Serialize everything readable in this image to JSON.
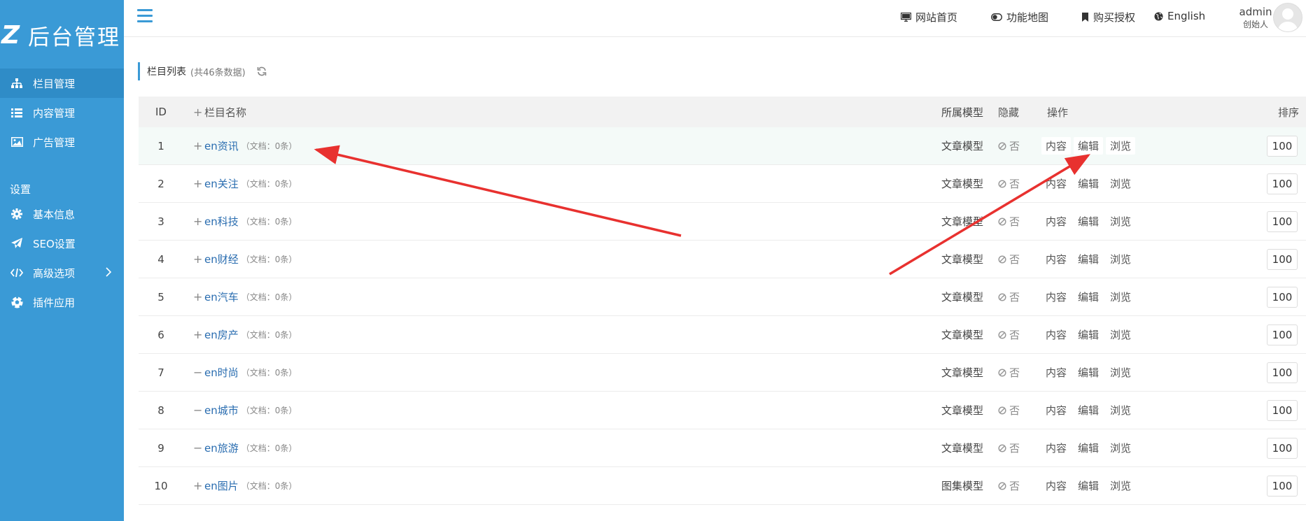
{
  "sidebar": {
    "logo_mark": "Z",
    "logo_text": "后台管理",
    "menu": [
      {
        "label": "栏目管理",
        "icon": "sitemap-icon",
        "active": true
      },
      {
        "label": "内容管理",
        "icon": "list-icon"
      },
      {
        "label": "广告管理",
        "icon": "image-icon"
      }
    ],
    "settings_label": "设置",
    "settings_menu": [
      {
        "label": "基本信息",
        "icon": "gear-icon"
      },
      {
        "label": "SEO设置",
        "icon": "paper-plane-icon"
      },
      {
        "label": "高级选项",
        "icon": "code-icon"
      },
      {
        "label": "插件应用",
        "icon": "soccer-ball-icon"
      }
    ]
  },
  "header": {
    "links": [
      {
        "label": "网站首页",
        "icon": "monitor-icon"
      },
      {
        "label": "功能地图",
        "icon": "toggle-icon"
      },
      {
        "label": "购买授权",
        "icon": "bookmark-icon"
      },
      {
        "label": "English",
        "icon": "globe-icon"
      }
    ],
    "user": {
      "name": "admin",
      "role": "创始人"
    }
  },
  "page": {
    "title": "栏目列表",
    "count_text": "(共46条数据)"
  },
  "table": {
    "columns": {
      "id": "ID",
      "name": "栏目名称",
      "model": "所属模型",
      "hidden": "隐藏",
      "ops": "操作",
      "sort": "排序"
    },
    "op_labels": [
      "内容",
      "编辑",
      "浏览"
    ],
    "rows": [
      {
        "id": "1",
        "expander": "+",
        "name": "en资讯",
        "docs": "（文档：0条）",
        "model": "文章模型",
        "hidden": "否",
        "sort": "100"
      },
      {
        "id": "2",
        "expander": "+",
        "name": "en关注",
        "docs": "（文档：0条）",
        "model": "文章模型",
        "hidden": "否",
        "sort": "100"
      },
      {
        "id": "3",
        "expander": "+",
        "name": "en科技",
        "docs": "（文档：0条）",
        "model": "文章模型",
        "hidden": "否",
        "sort": "100"
      },
      {
        "id": "4",
        "expander": "+",
        "name": "en财经",
        "docs": "（文档：0条）",
        "model": "文章模型",
        "hidden": "否",
        "sort": "100"
      },
      {
        "id": "5",
        "expander": "+",
        "name": "en汽车",
        "docs": "（文档：0条）",
        "model": "文章模型",
        "hidden": "否",
        "sort": "100"
      },
      {
        "id": "6",
        "expander": "+",
        "name": "en房产",
        "docs": "（文档：0条）",
        "model": "文章模型",
        "hidden": "否",
        "sort": "100"
      },
      {
        "id": "7",
        "expander": "−",
        "name": "en时尚",
        "docs": "（文档：0条）",
        "model": "文章模型",
        "hidden": "否",
        "sort": "100"
      },
      {
        "id": "8",
        "expander": "−",
        "name": "en城市",
        "docs": "（文档：0条）",
        "model": "文章模型",
        "hidden": "否",
        "sort": "100"
      },
      {
        "id": "9",
        "expander": "−",
        "name": "en旅游",
        "docs": "（文档：0条）",
        "model": "文章模型",
        "hidden": "否",
        "sort": "100"
      },
      {
        "id": "10",
        "expander": "+",
        "name": "en图片",
        "docs": "（文档：0条）",
        "model": "图集模型",
        "hidden": "否",
        "sort": "100"
      }
    ]
  },
  "colors": {
    "sidebar": "#3a9ad6",
    "link": "#2a6db0",
    "arrow": "#e8312f"
  }
}
